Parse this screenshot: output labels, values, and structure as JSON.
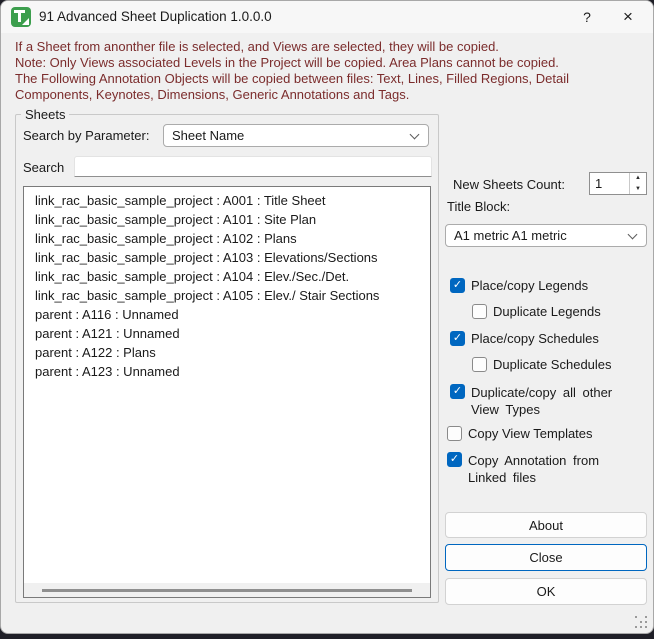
{
  "window": {
    "title": "91 Advanced Sheet Duplication 1.0.0.0",
    "help_glyph": "?",
    "close_glyph": "×"
  },
  "info": {
    "lines": [
      "If a Sheet from anonther file is selected, and Views are selected, they will be copied.",
      "Note: Only Views associated Levels in the Project will be copied. Area Plans cannot be copied.",
      "The Following Annotation Objects will be copied between files: Text, Lines, Filled Regions, Detail",
      "Components, Keynotes, Dimensions, Generic Annotations and Tags."
    ]
  },
  "sheets_group": {
    "label": "Sheets",
    "search_by_parameter_label": "Search by Parameter:",
    "parameter_value": "Sheet Name",
    "search_label": "Search",
    "search_value": "",
    "items": [
      "link_rac_basic_sample_project : A001 : Title Sheet",
      "link_rac_basic_sample_project : A101 : Site Plan",
      "link_rac_basic_sample_project : A102 : Plans",
      "link_rac_basic_sample_project : A103 : Elevations/Sections",
      "link_rac_basic_sample_project : A104 : Elev./Sec./Det.",
      "link_rac_basic_sample_project : A105 : Elev./ Stair Sections",
      "parent : A116 : Unnamed",
      "parent : A121 : Unnamed",
      "parent : A122 : Plans",
      "parent : A123 : Unnamed"
    ]
  },
  "options": {
    "new_sheets_count_label": "New Sheets Count:",
    "new_sheets_count_value": "1",
    "spinner_up_glyph": "▲",
    "spinner_down_glyph": "▼",
    "title_block_label": "Title Block:",
    "title_block_value": "A1 metric A1 metric",
    "check_glyph": "✓",
    "checkboxes": [
      {
        "label": "Place/copy Legends",
        "checked": true,
        "indented": false
      },
      {
        "label": "Duplicate Legends",
        "checked": false,
        "indented": true
      },
      {
        "label": "Place/copy Schedules",
        "checked": true,
        "indented": false
      },
      {
        "label": "Duplicate Schedules",
        "checked": false,
        "indented": true
      },
      {
        "label": "Duplicate/copy all other View Types",
        "checked": true,
        "indented": false
      },
      {
        "label": "Copy View Templates",
        "checked": false,
        "indented": false
      },
      {
        "label": "Copy Annotation from Linked files",
        "checked": true,
        "indented": false
      }
    ]
  },
  "buttons": {
    "about": "About",
    "close": "Close",
    "ok": "OK"
  },
  "colors": {
    "accent": "#0067c0",
    "info_text": "#7b2c2c",
    "app_icon_green": "#3c9e4d",
    "dialog_background": "#f0f0f0"
  }
}
